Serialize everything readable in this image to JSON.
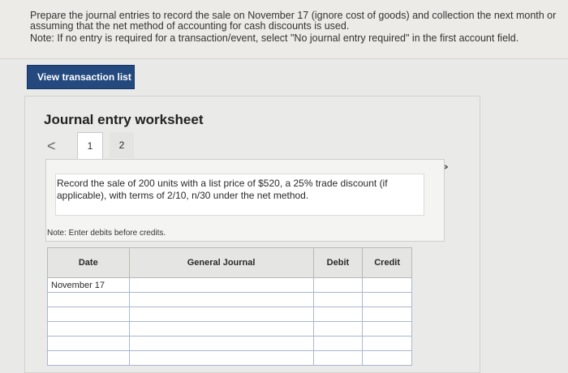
{
  "instructions": {
    "line1": "Prepare the journal entries to record the sale on November 17 (ignore cost of goods) and collection the next month or",
    "line2": "assuming that the net method of accounting for cash discounts is used.",
    "line3": "Note: If no entry is required for a transaction/event, select \"No journal entry required\" in the first account field."
  },
  "view_button": "View transaction list",
  "worksheet": {
    "title": "Journal entry worksheet",
    "tabs": [
      "1",
      "2"
    ],
    "prev_glyph": "<",
    "next_glyph": ">",
    "description_line1": "Record the sale of 200 units with a list price of $520, a 25% trade discount (if",
    "description_line2": "applicable), with terms of 2/10, n/30 under the net method.",
    "note": "Note: Enter debits before credits."
  },
  "table": {
    "headers": {
      "date": "Date",
      "account": "General Journal",
      "debit": "Debit",
      "credit": "Credit"
    },
    "rows": [
      {
        "date": "November 17"
      },
      {
        "date": ""
      },
      {
        "date": ""
      },
      {
        "date": ""
      },
      {
        "date": ""
      },
      {
        "date": ""
      }
    ]
  }
}
